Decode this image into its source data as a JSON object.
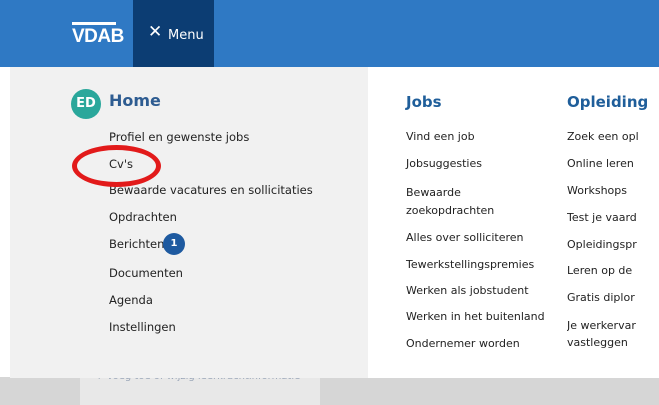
{
  "header": {
    "logo": "VDAB",
    "menu_label": "Menu",
    "colors": {
      "bar": "#2f79c4",
      "menu_button": "#0c3d73"
    }
  },
  "profile": {
    "initials": "ED",
    "avatar_color": "#2aa79b"
  },
  "home": {
    "title": "Home",
    "items": [
      {
        "label": "Profiel en gewenste jobs"
      },
      {
        "label": "Cv's"
      },
      {
        "label": "Bewaarde vacatures en sollicitaties"
      },
      {
        "label": "Opdrachten"
      },
      {
        "label": "Berichten"
      },
      {
        "label": "Documenten"
      },
      {
        "label": "Agenda"
      },
      {
        "label": "Instellingen"
      }
    ],
    "messages_badge": "1"
  },
  "jobs": {
    "title": "Jobs",
    "items": [
      {
        "label": "Vind een job"
      },
      {
        "label": "Jobsuggesties"
      },
      {
        "label_line1": "Bewaarde",
        "label_line2": "zoekopdrachten"
      },
      {
        "label": "Alles over solliciteren"
      },
      {
        "label": "Tewerkstellingspremies"
      },
      {
        "label": "Werken als jobstudent"
      },
      {
        "label": "Werken in het buitenland"
      },
      {
        "label": "Ondernemer worden"
      }
    ]
  },
  "opleidingen": {
    "title": "Opleiding",
    "items": [
      {
        "label": "Zoek een opl"
      },
      {
        "label": "Online leren"
      },
      {
        "label": "Workshops"
      },
      {
        "label": "Test je vaard"
      },
      {
        "label": "Opleidingspr"
      },
      {
        "label": "Leren op de"
      },
      {
        "label": "Gratis diplor"
      },
      {
        "label_line1": "Je werkervar",
        "label_line2": "vastleggen"
      }
    ]
  },
  "background": {
    "link_text": "+ Voeg toe of wijzig leerkrachtinformatie"
  },
  "annotation": {
    "highlight_color": "#e21a1a"
  }
}
